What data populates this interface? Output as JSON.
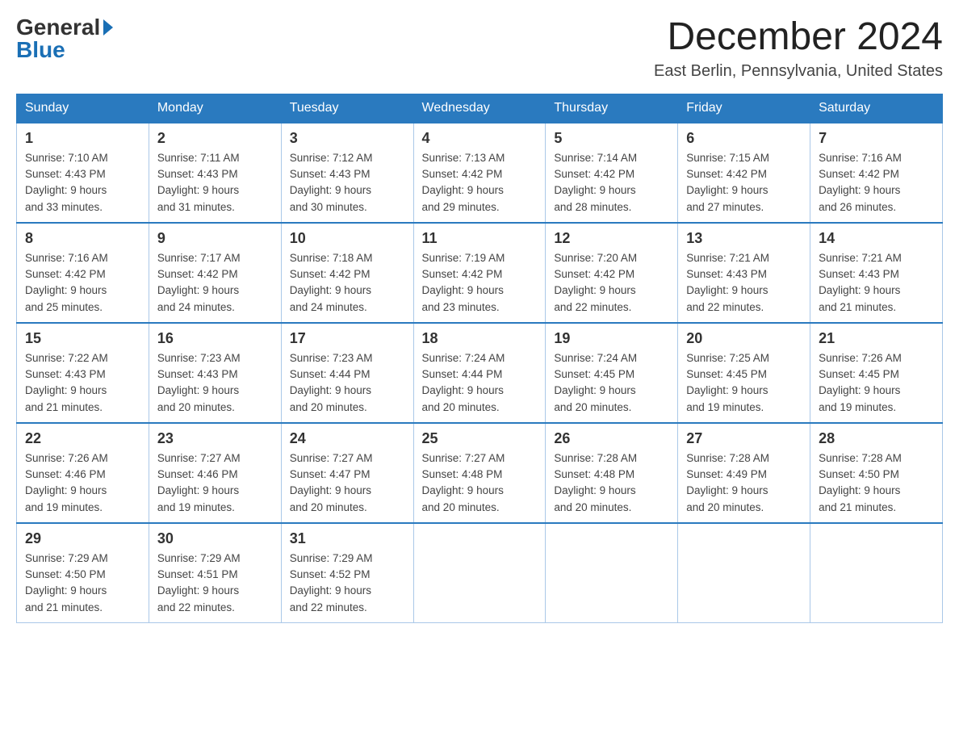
{
  "logo": {
    "general": "General",
    "blue": "Blue"
  },
  "title": "December 2024",
  "subtitle": "East Berlin, Pennsylvania, United States",
  "days_of_week": [
    "Sunday",
    "Monday",
    "Tuesday",
    "Wednesday",
    "Thursday",
    "Friday",
    "Saturday"
  ],
  "weeks": [
    [
      {
        "day": "1",
        "sunrise": "7:10 AM",
        "sunset": "4:43 PM",
        "daylight": "9 hours and 33 minutes."
      },
      {
        "day": "2",
        "sunrise": "7:11 AM",
        "sunset": "4:43 PM",
        "daylight": "9 hours and 31 minutes."
      },
      {
        "day": "3",
        "sunrise": "7:12 AM",
        "sunset": "4:43 PM",
        "daylight": "9 hours and 30 minutes."
      },
      {
        "day": "4",
        "sunrise": "7:13 AM",
        "sunset": "4:42 PM",
        "daylight": "9 hours and 29 minutes."
      },
      {
        "day": "5",
        "sunrise": "7:14 AM",
        "sunset": "4:42 PM",
        "daylight": "9 hours and 28 minutes."
      },
      {
        "day": "6",
        "sunrise": "7:15 AM",
        "sunset": "4:42 PM",
        "daylight": "9 hours and 27 minutes."
      },
      {
        "day": "7",
        "sunrise": "7:16 AM",
        "sunset": "4:42 PM",
        "daylight": "9 hours and 26 minutes."
      }
    ],
    [
      {
        "day": "8",
        "sunrise": "7:16 AM",
        "sunset": "4:42 PM",
        "daylight": "9 hours and 25 minutes."
      },
      {
        "day": "9",
        "sunrise": "7:17 AM",
        "sunset": "4:42 PM",
        "daylight": "9 hours and 24 minutes."
      },
      {
        "day": "10",
        "sunrise": "7:18 AM",
        "sunset": "4:42 PM",
        "daylight": "9 hours and 24 minutes."
      },
      {
        "day": "11",
        "sunrise": "7:19 AM",
        "sunset": "4:42 PM",
        "daylight": "9 hours and 23 minutes."
      },
      {
        "day": "12",
        "sunrise": "7:20 AM",
        "sunset": "4:42 PM",
        "daylight": "9 hours and 22 minutes."
      },
      {
        "day": "13",
        "sunrise": "7:21 AM",
        "sunset": "4:43 PM",
        "daylight": "9 hours and 22 minutes."
      },
      {
        "day": "14",
        "sunrise": "7:21 AM",
        "sunset": "4:43 PM",
        "daylight": "9 hours and 21 minutes."
      }
    ],
    [
      {
        "day": "15",
        "sunrise": "7:22 AM",
        "sunset": "4:43 PM",
        "daylight": "9 hours and 21 minutes."
      },
      {
        "day": "16",
        "sunrise": "7:23 AM",
        "sunset": "4:43 PM",
        "daylight": "9 hours and 20 minutes."
      },
      {
        "day": "17",
        "sunrise": "7:23 AM",
        "sunset": "4:44 PM",
        "daylight": "9 hours and 20 minutes."
      },
      {
        "day": "18",
        "sunrise": "7:24 AM",
        "sunset": "4:44 PM",
        "daylight": "9 hours and 20 minutes."
      },
      {
        "day": "19",
        "sunrise": "7:24 AM",
        "sunset": "4:45 PM",
        "daylight": "9 hours and 20 minutes."
      },
      {
        "day": "20",
        "sunrise": "7:25 AM",
        "sunset": "4:45 PM",
        "daylight": "9 hours and 19 minutes."
      },
      {
        "day": "21",
        "sunrise": "7:26 AM",
        "sunset": "4:45 PM",
        "daylight": "9 hours and 19 minutes."
      }
    ],
    [
      {
        "day": "22",
        "sunrise": "7:26 AM",
        "sunset": "4:46 PM",
        "daylight": "9 hours and 19 minutes."
      },
      {
        "day": "23",
        "sunrise": "7:27 AM",
        "sunset": "4:46 PM",
        "daylight": "9 hours and 19 minutes."
      },
      {
        "day": "24",
        "sunrise": "7:27 AM",
        "sunset": "4:47 PM",
        "daylight": "9 hours and 20 minutes."
      },
      {
        "day": "25",
        "sunrise": "7:27 AM",
        "sunset": "4:48 PM",
        "daylight": "9 hours and 20 minutes."
      },
      {
        "day": "26",
        "sunrise": "7:28 AM",
        "sunset": "4:48 PM",
        "daylight": "9 hours and 20 minutes."
      },
      {
        "day": "27",
        "sunrise": "7:28 AM",
        "sunset": "4:49 PM",
        "daylight": "9 hours and 20 minutes."
      },
      {
        "day": "28",
        "sunrise": "7:28 AM",
        "sunset": "4:50 PM",
        "daylight": "9 hours and 21 minutes."
      }
    ],
    [
      {
        "day": "29",
        "sunrise": "7:29 AM",
        "sunset": "4:50 PM",
        "daylight": "9 hours and 21 minutes."
      },
      {
        "day": "30",
        "sunrise": "7:29 AM",
        "sunset": "4:51 PM",
        "daylight": "9 hours and 22 minutes."
      },
      {
        "day": "31",
        "sunrise": "7:29 AM",
        "sunset": "4:52 PM",
        "daylight": "9 hours and 22 minutes."
      },
      null,
      null,
      null,
      null
    ]
  ],
  "labels": {
    "sunrise": "Sunrise:",
    "sunset": "Sunset:",
    "daylight": "Daylight:"
  }
}
